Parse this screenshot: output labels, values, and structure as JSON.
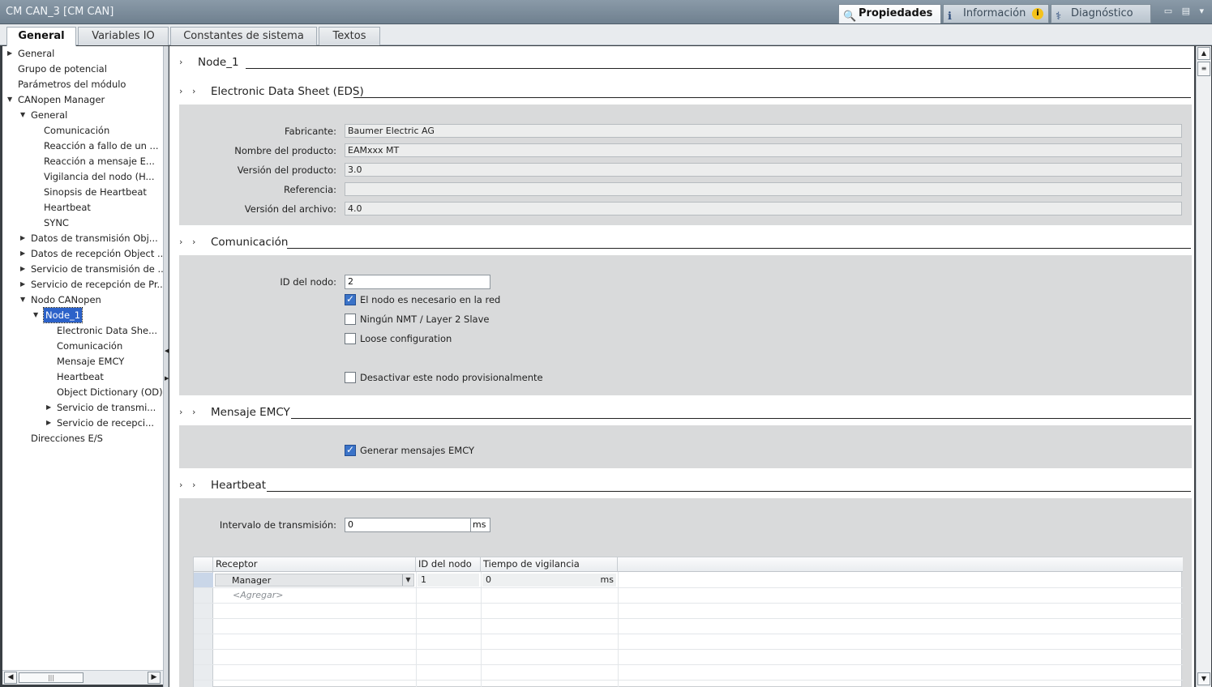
{
  "window": {
    "title": "CM CAN_3 [CM CAN]",
    "panel_tabs": [
      {
        "label": "Propiedades",
        "icon": "properties-magnifier-icon"
      },
      {
        "label": "Información",
        "icon": "info-icon",
        "badge": "i"
      },
      {
        "label": "Diagnóstico",
        "icon": "diagnostics-icon"
      }
    ],
    "controls": "▭ ▤ ▾"
  },
  "main_tabs": [
    "General",
    "Variables IO",
    "Constantes de sistema",
    "Textos"
  ],
  "nav": [
    {
      "label": "General",
      "twisty": "▶"
    },
    {
      "label": "Grupo de potencial"
    },
    {
      "label": "Parámetros del módulo"
    },
    {
      "label": "CANopen Manager",
      "twisty": "▼"
    },
    {
      "label": "General",
      "twisty": "▼"
    },
    {
      "label": "Comunicación"
    },
    {
      "label": "Reacción a fallo de un ..."
    },
    {
      "label": "Reacción a mensaje E..."
    },
    {
      "label": "Vigilancia del nodo (H..."
    },
    {
      "label": "Sinopsis de Heartbeat"
    },
    {
      "label": "Heartbeat"
    },
    {
      "label": "SYNC"
    },
    {
      "label": "Datos de transmisión Obj...",
      "twisty": "▶"
    },
    {
      "label": "Datos de recepción Object ...",
      "twisty": "▶"
    },
    {
      "label": "Servicio de transmisión de ...",
      "twisty": "▶"
    },
    {
      "label": "Servicio de recepción de Pr...",
      "twisty": "▶"
    },
    {
      "label": "Nodo CANopen",
      "twisty": "▼"
    },
    {
      "label": "Node_1",
      "twisty": "▼",
      "selected": true
    },
    {
      "label": "Electronic Data She..."
    },
    {
      "label": "Comunicación"
    },
    {
      "label": "Mensaje EMCY"
    },
    {
      "label": "Heartbeat"
    },
    {
      "label": "Object Dictionary (OD)"
    },
    {
      "label": "Servicio de transmi...",
      "twisty": "▶"
    },
    {
      "label": "Servicio de recepci...",
      "twisty": "▶"
    },
    {
      "label": "Direcciones E/S"
    }
  ],
  "sections": {
    "node": {
      "title": "Node_1"
    },
    "eds": {
      "title": "Electronic Data Sheet (EDS)",
      "fields": [
        {
          "label": "Fabricante:",
          "value": "Baumer Electric AG"
        },
        {
          "label": "Nombre del producto:",
          "value": "EAMxxx MT"
        },
        {
          "label": "Versión del producto:",
          "value": "3.0"
        },
        {
          "label": "Referencia:",
          "value": ""
        },
        {
          "label": "Versión del archivo:",
          "value": "4.0"
        }
      ]
    },
    "comunicacion": {
      "title": "Comunicación",
      "node_id_label": "ID del nodo:",
      "node_id_value": "2",
      "checkboxes": [
        {
          "label": "El nodo es necesario en la red",
          "checked": true
        },
        {
          "label": "Ningún NMT / Layer 2 Slave",
          "checked": false
        },
        {
          "label": "Loose configuration",
          "checked": false
        },
        {
          "label": "Desactivar este nodo provisionalmente",
          "checked": false
        }
      ]
    },
    "emcy": {
      "title": "Mensaje EMCY",
      "checkbox": {
        "label": "Generar mensajes EMCY",
        "checked": true
      }
    },
    "heartbeat": {
      "title": "Heartbeat",
      "interval_label": "Intervalo de transmisión:",
      "interval_value": "0",
      "interval_unit": "ms",
      "table": {
        "headers": [
          "Receptor",
          "ID del nodo",
          "Tiempo de vigilancia"
        ],
        "rows": [
          {
            "receptor": "Manager",
            "node_id": "1",
            "time": "0",
            "unit": "ms"
          }
        ],
        "add_placeholder": "<Agregar>"
      }
    }
  },
  "colors": {
    "accent": "#2c62c9",
    "panel": "#d9dadb",
    "titlebar": "#6f808f"
  }
}
